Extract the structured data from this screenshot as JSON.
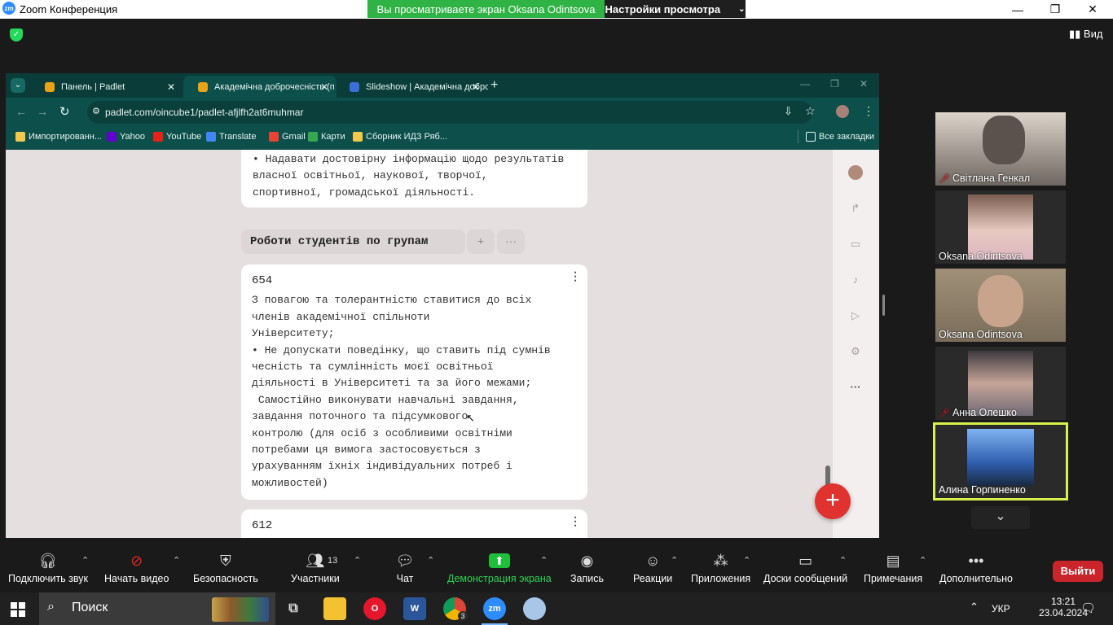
{
  "zoom": {
    "window_title": "Zoom Конференция",
    "logo_text": "zm",
    "share_banner": "Вы просматриваете экран Oksana Odintsova",
    "view_settings": "Настройки просмотра",
    "view_button": "Вид",
    "window_controls": {
      "minimize": "—",
      "restore": "❐",
      "close": "✕"
    }
  },
  "browser": {
    "tabs": [
      {
        "label": "Панель | Padlet",
        "active": false
      },
      {
        "label": "Академічна доброчесність (п",
        "active": true
      },
      {
        "label": "Slideshow | Академічна добро",
        "active": false
      }
    ],
    "new_tab": "+",
    "url": "padlet.com/oincube1/padlet-afjlfh2at6muhmar",
    "bookmarks": [
      "Импортированн...",
      "Yahoo",
      "YouTube",
      "Translate",
      "Gmail",
      "Карти",
      "Сборник ИДЗ Ряб..."
    ],
    "all_bookmarks": "Все закладки"
  },
  "padlet": {
    "card0_body": "• Надавати достовірну інформацію щодо результатів\nвласної освітньої, наукової, творчої,\nспортивної, громадської діяльності.",
    "section_title": "Роботи студентів по групам",
    "section_add": "+",
    "section_more": "···",
    "card1_title": "654",
    "card1_body": "З повагою та толерантністю ставитися до всіх\nчленів академічної спільноти\nУніверситету;\n• Не допускати поведінку, що ставить під сумнів\nчесність та сумлінність моєї освітньої\nдіяльності в Університеті та за його межами;\n Самостійно виконувати навчальні завдання,\nзавдання поточного та підсумкового\nконтролю (для осіб з особливими освітніми\nпотребами ця вимога застосовується з\nурахуванням їхніх індивідуальних потреб і\nможливостей)",
    "card2_title": "612",
    "fab": "+",
    "card_menu": "⋮"
  },
  "participants": [
    {
      "name": "Світлана Генкал",
      "muted": true,
      "bg": "#8a8480"
    },
    {
      "name": "Oksana Odintsova",
      "muted": false,
      "bg": "#b09080"
    },
    {
      "name": "Oksana Odintsova",
      "muted": false,
      "bg": "#8c7a60"
    },
    {
      "name": "Анна Олешко",
      "muted": true,
      "bg": "#6d6a75"
    },
    {
      "name": "Алина Горпиненко",
      "muted": false,
      "bg": "#3b5e9c"
    }
  ],
  "toolbar": {
    "join_audio": "Подключить звук",
    "start_video": "Начать видео",
    "security": "Безопасность",
    "participants": "Участники",
    "participants_count": "13",
    "chat": "Чат",
    "share_screen": "Демонстрация экрана",
    "record": "Запись",
    "reactions": "Реакции",
    "apps": "Приложения",
    "whiteboards": "Доски сообщений",
    "notes": "Примечания",
    "more": "Дополнительно",
    "leave": "Выйти"
  },
  "taskbar": {
    "search": "Поиск",
    "language": "УКР",
    "time": "13:21",
    "date": "23.04.2024",
    "chrome_badge": "3"
  },
  "colors": {
    "share_green": "#2fb344",
    "leave_red": "#c9252b",
    "padlet_fab": "#e0322f",
    "speaker_border": "#d8f04a",
    "browser_teal": "#0d4f4a"
  }
}
